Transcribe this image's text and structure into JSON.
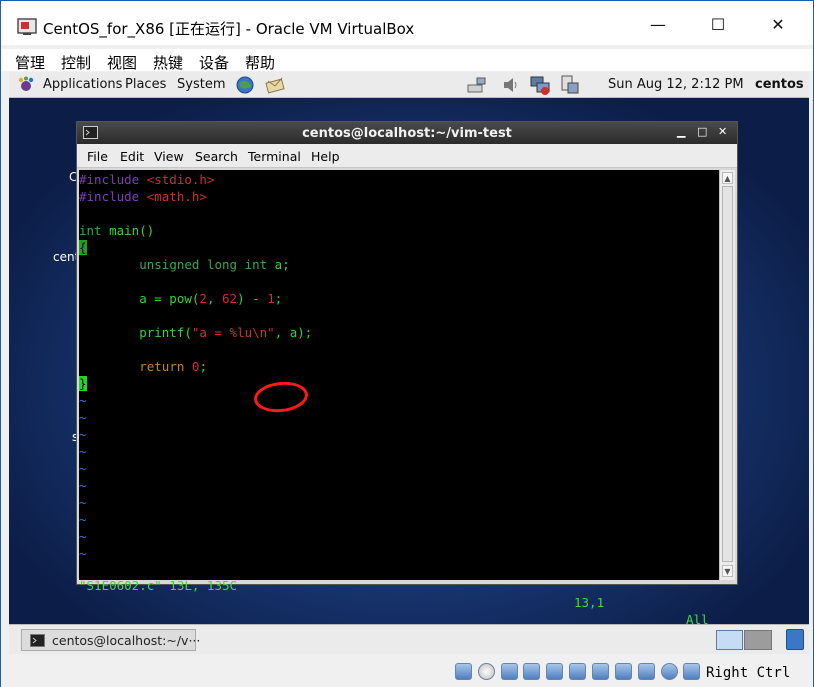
{
  "window": {
    "title": "CentOS_for_X86 [正在运行] - Oracle VM VirtualBox",
    "minimize": "—",
    "maximize": "☐",
    "close": "✕"
  },
  "vbox_menu": [
    "管理",
    "控制",
    "视图",
    "热键",
    "设备",
    "帮助"
  ],
  "gnome_panel": {
    "applications": "Applications",
    "places": "Places",
    "system": "System",
    "clock": "Sun Aug 12,  2:12 PM",
    "user": "centos"
  },
  "desktop_fragments": [
    "C",
    "cent",
    "s"
  ],
  "terminal": {
    "title": "centos@localhost:~/vim-test",
    "menu": [
      "File",
      "Edit",
      "View",
      "Search",
      "Terminal",
      "Help"
    ],
    "code": {
      "l1a": "#include ",
      "l1b": "<stdio.h>",
      "l2a": "#include ",
      "l2b": "<math.h>",
      "l4a": "int",
      "l4b": " main()",
      "l5": "{",
      "l7a": "        ",
      "l7b": "unsigned long int",
      "l7c": " a;",
      "l9a": "        a = pow(",
      "l9b": "2",
      "l9c": ", ",
      "l9d": "62",
      "l9e": ") - ",
      "l9f": "1",
      "l9g": ";",
      "l11a": "        printf(",
      "l11b": "\"a = %lu\\n\"",
      "l11c": ", a);",
      "l13a": "        ",
      "l13b": "return",
      "l13c": " ",
      "l13d": "0",
      "l13e": ";",
      "l14": "}",
      "tilde": "~"
    },
    "status": {
      "file": "\"S1E0602.c\" 13L, 135C",
      "pos": "13,1",
      "scroll": "All"
    }
  },
  "taskbar": {
    "item": "centos@localhost:~/v···"
  },
  "vbox_status": {
    "host_key": "Right Ctrl"
  },
  "colors": {
    "annotation": "#ff1a1a",
    "vim_green": "#3fd83f",
    "desktop_blue": "#1a3a78"
  }
}
